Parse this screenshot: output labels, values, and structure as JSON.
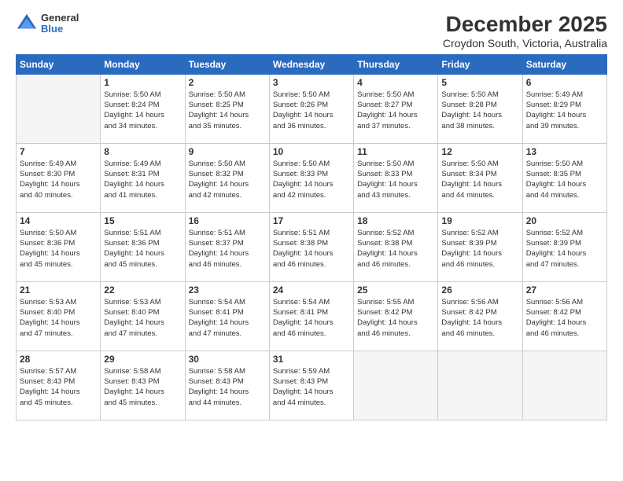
{
  "logo": {
    "general": "General",
    "blue": "Blue"
  },
  "title": "December 2025",
  "subtitle": "Croydon South, Victoria, Australia",
  "days_header": [
    "Sunday",
    "Monday",
    "Tuesday",
    "Wednesday",
    "Thursday",
    "Friday",
    "Saturday"
  ],
  "weeks": [
    [
      {
        "day": "",
        "info": ""
      },
      {
        "day": "1",
        "info": "Sunrise: 5:50 AM\nSunset: 8:24 PM\nDaylight: 14 hours\nand 34 minutes."
      },
      {
        "day": "2",
        "info": "Sunrise: 5:50 AM\nSunset: 8:25 PM\nDaylight: 14 hours\nand 35 minutes."
      },
      {
        "day": "3",
        "info": "Sunrise: 5:50 AM\nSunset: 8:26 PM\nDaylight: 14 hours\nand 36 minutes."
      },
      {
        "day": "4",
        "info": "Sunrise: 5:50 AM\nSunset: 8:27 PM\nDaylight: 14 hours\nand 37 minutes."
      },
      {
        "day": "5",
        "info": "Sunrise: 5:50 AM\nSunset: 8:28 PM\nDaylight: 14 hours\nand 38 minutes."
      },
      {
        "day": "6",
        "info": "Sunrise: 5:49 AM\nSunset: 8:29 PM\nDaylight: 14 hours\nand 39 minutes."
      }
    ],
    [
      {
        "day": "7",
        "info": "Sunrise: 5:49 AM\nSunset: 8:30 PM\nDaylight: 14 hours\nand 40 minutes."
      },
      {
        "day": "8",
        "info": "Sunrise: 5:49 AM\nSunset: 8:31 PM\nDaylight: 14 hours\nand 41 minutes."
      },
      {
        "day": "9",
        "info": "Sunrise: 5:50 AM\nSunset: 8:32 PM\nDaylight: 14 hours\nand 42 minutes."
      },
      {
        "day": "10",
        "info": "Sunrise: 5:50 AM\nSunset: 8:33 PM\nDaylight: 14 hours\nand 42 minutes."
      },
      {
        "day": "11",
        "info": "Sunrise: 5:50 AM\nSunset: 8:33 PM\nDaylight: 14 hours\nand 43 minutes."
      },
      {
        "day": "12",
        "info": "Sunrise: 5:50 AM\nSunset: 8:34 PM\nDaylight: 14 hours\nand 44 minutes."
      },
      {
        "day": "13",
        "info": "Sunrise: 5:50 AM\nSunset: 8:35 PM\nDaylight: 14 hours\nand 44 minutes."
      }
    ],
    [
      {
        "day": "14",
        "info": "Sunrise: 5:50 AM\nSunset: 8:36 PM\nDaylight: 14 hours\nand 45 minutes."
      },
      {
        "day": "15",
        "info": "Sunrise: 5:51 AM\nSunset: 8:36 PM\nDaylight: 14 hours\nand 45 minutes."
      },
      {
        "day": "16",
        "info": "Sunrise: 5:51 AM\nSunset: 8:37 PM\nDaylight: 14 hours\nand 46 minutes."
      },
      {
        "day": "17",
        "info": "Sunrise: 5:51 AM\nSunset: 8:38 PM\nDaylight: 14 hours\nand 46 minutes."
      },
      {
        "day": "18",
        "info": "Sunrise: 5:52 AM\nSunset: 8:38 PM\nDaylight: 14 hours\nand 46 minutes."
      },
      {
        "day": "19",
        "info": "Sunrise: 5:52 AM\nSunset: 8:39 PM\nDaylight: 14 hours\nand 46 minutes."
      },
      {
        "day": "20",
        "info": "Sunrise: 5:52 AM\nSunset: 8:39 PM\nDaylight: 14 hours\nand 47 minutes."
      }
    ],
    [
      {
        "day": "21",
        "info": "Sunrise: 5:53 AM\nSunset: 8:40 PM\nDaylight: 14 hours\nand 47 minutes."
      },
      {
        "day": "22",
        "info": "Sunrise: 5:53 AM\nSunset: 8:40 PM\nDaylight: 14 hours\nand 47 minutes."
      },
      {
        "day": "23",
        "info": "Sunrise: 5:54 AM\nSunset: 8:41 PM\nDaylight: 14 hours\nand 47 minutes."
      },
      {
        "day": "24",
        "info": "Sunrise: 5:54 AM\nSunset: 8:41 PM\nDaylight: 14 hours\nand 46 minutes."
      },
      {
        "day": "25",
        "info": "Sunrise: 5:55 AM\nSunset: 8:42 PM\nDaylight: 14 hours\nand 46 minutes."
      },
      {
        "day": "26",
        "info": "Sunrise: 5:56 AM\nSunset: 8:42 PM\nDaylight: 14 hours\nand 46 minutes."
      },
      {
        "day": "27",
        "info": "Sunrise: 5:56 AM\nSunset: 8:42 PM\nDaylight: 14 hours\nand 46 minutes."
      }
    ],
    [
      {
        "day": "28",
        "info": "Sunrise: 5:57 AM\nSunset: 8:43 PM\nDaylight: 14 hours\nand 45 minutes."
      },
      {
        "day": "29",
        "info": "Sunrise: 5:58 AM\nSunset: 8:43 PM\nDaylight: 14 hours\nand 45 minutes."
      },
      {
        "day": "30",
        "info": "Sunrise: 5:58 AM\nSunset: 8:43 PM\nDaylight: 14 hours\nand 44 minutes."
      },
      {
        "day": "31",
        "info": "Sunrise: 5:59 AM\nSunset: 8:43 PM\nDaylight: 14 hours\nand 44 minutes."
      },
      {
        "day": "",
        "info": ""
      },
      {
        "day": "",
        "info": ""
      },
      {
        "day": "",
        "info": ""
      }
    ]
  ]
}
